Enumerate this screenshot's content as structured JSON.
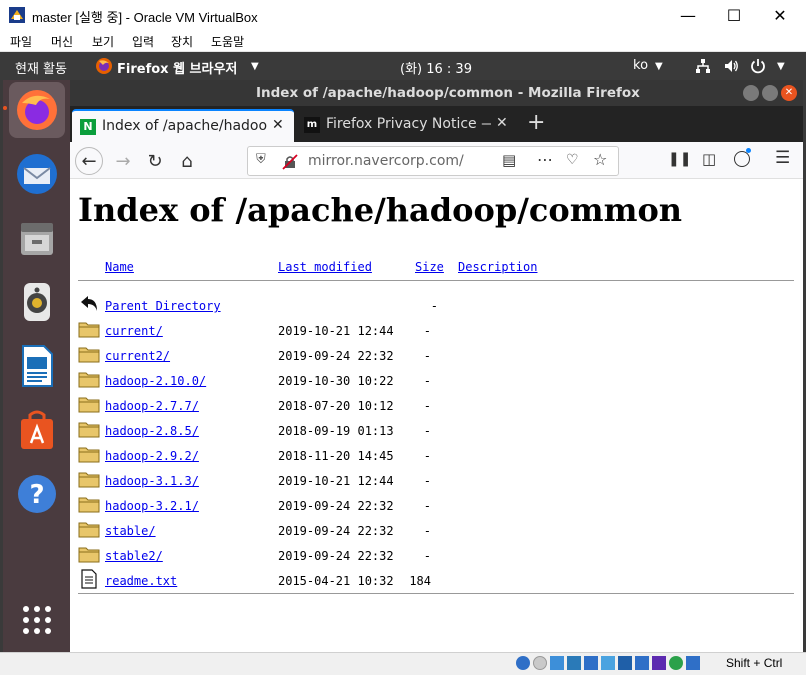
{
  "vbox": {
    "title": "master [실행 중] - Oracle VM VirtualBox",
    "menu": [
      "파일",
      "머신",
      "보기",
      "입력",
      "장치",
      "도움말"
    ],
    "status_text": "Shift + Ctrl"
  },
  "ubuntu": {
    "activities": "현재 활동",
    "app_menu": "Firefox 웹 브라우저",
    "clock": "(화) 16 : 39",
    "keyboard": "ko"
  },
  "firefox": {
    "window_title": "Index of /apache/hadoop/common - Mozilla Firefox",
    "tabs": [
      {
        "label": "Index of /apache/hadoop"
      },
      {
        "label": "Firefox Privacy Notice —"
      }
    ],
    "url": "mirror.navercorp.com/a"
  },
  "page": {
    "heading": "Index of /apache/hadoop/common",
    "columns": {
      "name": "Name",
      "modified": "Last modified",
      "size": "Size",
      "description": "Description"
    },
    "parent": {
      "name": "Parent Directory",
      "size": "-"
    },
    "entries": [
      {
        "name": "current/",
        "modified": "2019-10-21 12:44",
        "size": "-",
        "type": "folder"
      },
      {
        "name": "current2/",
        "modified": "2019-09-24 22:32",
        "size": "-",
        "type": "folder"
      },
      {
        "name": "hadoop-2.10.0/",
        "modified": "2019-10-30 10:22",
        "size": "-",
        "type": "folder"
      },
      {
        "name": "hadoop-2.7.7/",
        "modified": "2018-07-20 10:12",
        "size": "-",
        "type": "folder"
      },
      {
        "name": "hadoop-2.8.5/",
        "modified": "2018-09-19 01:13",
        "size": "-",
        "type": "folder"
      },
      {
        "name": "hadoop-2.9.2/",
        "modified": "2018-11-20 14:45",
        "size": "-",
        "type": "folder"
      },
      {
        "name": "hadoop-3.1.3/",
        "modified": "2019-10-21 12:44",
        "size": "-",
        "type": "folder"
      },
      {
        "name": "hadoop-3.2.1/",
        "modified": "2019-09-24 22:32",
        "size": "-",
        "type": "folder"
      },
      {
        "name": "stable/",
        "modified": "2019-09-24 22:32",
        "size": "-",
        "type": "folder"
      },
      {
        "name": "stable2/",
        "modified": "2019-09-24 22:32",
        "size": "-",
        "type": "folder"
      },
      {
        "name": "readme.txt",
        "modified": "2015-04-21 10:32",
        "size": "184",
        "type": "file"
      }
    ]
  },
  "colors": {
    "link": "#0000ee",
    "dock_bg": "#4a3b3f",
    "topbar_bg": "#3a3a3a",
    "folder": "#e8c66a"
  }
}
